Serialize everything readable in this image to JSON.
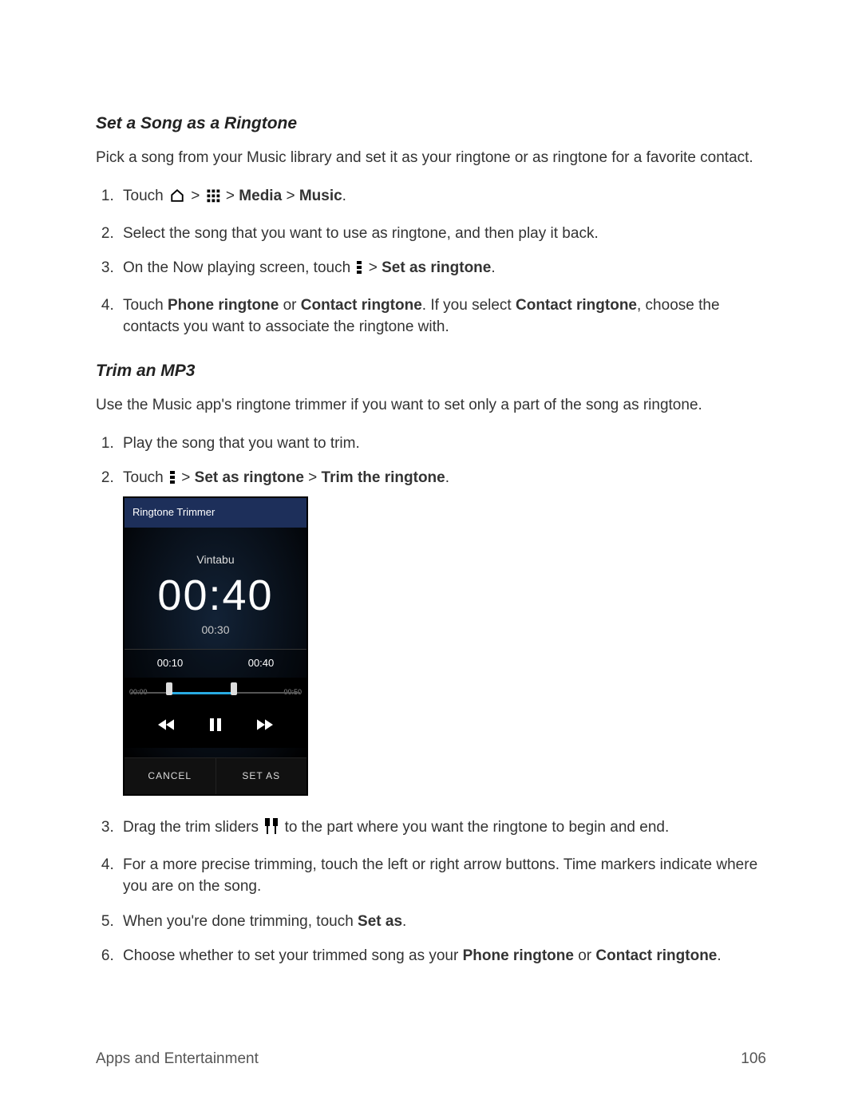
{
  "section1": {
    "heading": "Set a Song as a Ringtone",
    "desc": "Pick a song from your Music library and set it as your ringtone or as ringtone for a favorite contact.",
    "step1_pre": "Touch ",
    "step1_gt1": " > ",
    "step1_gt2": " > ",
    "step1_media": "Media",
    "step1_gt3": " > ",
    "step1_music": "Music",
    "step1_end": ".",
    "step2": "Select the song that you want to use as ringtone, and then play it back.",
    "step3_pre": "On the Now playing screen, touch ",
    "step3_gt": " > ",
    "step3_bold": "Set as ringtone",
    "step3_end": ".",
    "step4_pre": "Touch ",
    "step4_b1": "Phone ringtone",
    "step4_or": " or ",
    "step4_b2": "Contact ringtone",
    "step4_mid": ". If you select ",
    "step4_b3": "Contact ringtone",
    "step4_end": ", choose the contacts you want to associate the ringtone with."
  },
  "section2": {
    "heading": "Trim an MP3",
    "desc": "Use the Music app's ringtone trimmer if you want to set only a part of the song as ringtone.",
    "step1": "Play the song that you want to trim.",
    "step2_pre": "Touch ",
    "step2_gt": " > ",
    "step2_b1": "Set as ringtone",
    "step2_gt2": " > ",
    "step2_b2": "Trim the ringtone",
    "step2_end": ".",
    "step3_pre": "Drag the trim sliders ",
    "step3_post": " to the part where you want the ringtone to begin and end.",
    "step4": "For a more precise trimming, touch the left or right arrow buttons. Time markers indicate where you are on the song.",
    "step5_pre": "When you're done trimming, touch ",
    "step5_b": "Set as",
    "step5_end": ".",
    "step6_pre": "Choose whether to set your trimmed song as your ",
    "step6_b1": "Phone ringtone",
    "step6_or": " or ",
    "step6_b2": "Contact ringtone",
    "step6_end": "."
  },
  "phone": {
    "title": "Ringtone Trimmer",
    "track": "Vintabu",
    "big_time": "00:40",
    "small_time": "00:30",
    "left_time": "00:10",
    "right_time": "00:40",
    "range_start": "00:00",
    "range_end": "00:50",
    "cancel": "CANCEL",
    "setas": "SET AS"
  },
  "footer": {
    "section": "Apps and Entertainment",
    "page": "106"
  }
}
